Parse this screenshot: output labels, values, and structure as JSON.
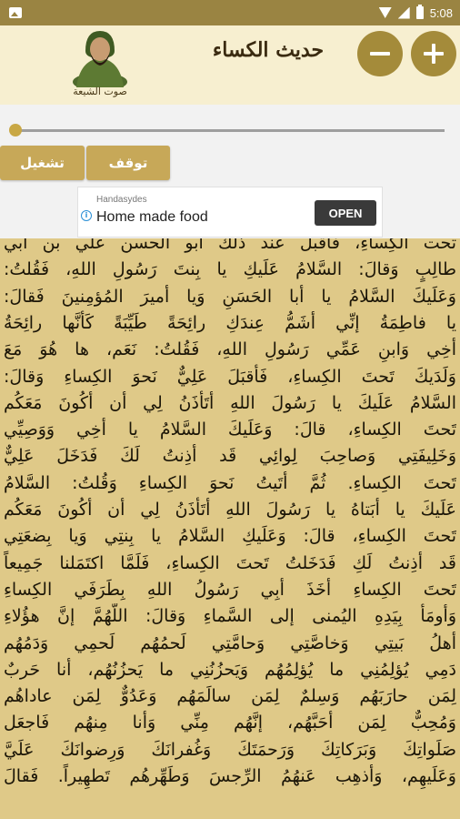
{
  "status_bar": {
    "time": "5:08",
    "icons": [
      "image-icon",
      "wifi-icon",
      "signal-icon",
      "battery-icon"
    ]
  },
  "toolbar": {
    "title": "حديث الكساء",
    "logo_caption": "صوت الشيعة",
    "icons": {
      "zoom_in": "plus-icon",
      "zoom_out": "minus-icon"
    }
  },
  "player": {
    "progress": 0,
    "play_label": "تشغيل",
    "stop_label": "توقف"
  },
  "ad": {
    "advertiser": "Handasydes",
    "headline": "Home made food",
    "cta": "OPEN"
  },
  "colors": {
    "status_bar": "#9a8442",
    "toolbar_bg": "#f7efd0",
    "accent": "#a48b3a",
    "button": "#c7a858",
    "text_bg": "#dfc988"
  },
  "text_lines": [
    "تحت الكِساءِ، فأقبل عند ذلك أبو الحسن علي بن أبي",
    "طالِبٍ وَقالَ: السَّلامُ عَلَيكِ يا بِنتَ رَسُولِ اللهِ، فَقُلتُ:",
    "وَعَلَيكَ السَّلامُ يا أبا الحَسَنِ وَيا أميرَ المُؤمِنينَ فَقالَ:",
    "يا فاطِمَةُ إنِّي أشَمُّ عِندَكِ رائِحَةً طَيِّبَةً كَأنَّها رائِحَةُ",
    "أخِي وَابنِ عَمِّي رَسُولِ اللهِ، فَقُلتُ: نَعَم، ها هُوَ مَعَ",
    "وَلَدَيكَ تَحتَ الكِساءِ، فَأقبَلَ عَلِيٌّ نَحوَ الكِساءِ وَقالَ:",
    "السَّلامُ عَلَيكَ يا رَسُولَ اللهِ أتَأذَنُ لِي أن أكُونَ مَعَكُم",
    "تَحتَ الكِساءِ، قالَ: وَعَلَيكَ السَّلامُ يا أخِي وَوَصِيِّي",
    "وَخَلِيفَتِي وَصاحِبَ لِوائِي قَد أذِنتُ لَكَ فَدَخَلَ عَلِيٌّ",
    "تَحتَ الكِساءِ. ثُمَّ أتَيتُ نَحوَ الكِساءِ وَقُلتُ: السَّلامُ",
    "عَلَيكَ يا أبَتاهُ يا رَسُولَ اللهِ أتَأذَنُ لِي أن أكُونَ مَعَكُم",
    "تَحتَ الكِساءِ، قالَ: وَعَلَيكِ السَّلامُ يا بِنتِي وَيا بِضعَتِي",
    "قَد أذِنتُ لَكِ فَدَخَلتُ تَحتَ الكِساءِ، فَلَمَّا اكتَمَلنا جَمِيعاً",
    "تَحتَ الكِساءِ أخَذَ أبِي رَسُولُ اللهِ بِطَرَفَي الكِساءِ",
    "وَأومَأ بِيَدِهِ اليُمنى إلى السَّماءِ وَقالَ: اللّهُمَّ إنَّ هؤُلاءِ",
    "أهلُ بَيتِي وَخاصَّتِي وَحامَّتِي لَحمُهُم لَحمِي وَدَمُهُم",
    "دَمِي يُؤلِمُنِي ما يُؤلِمُهُم وَيَحزُنُنِي ما يَحزُنُهُم، أنا حَربٌ",
    "لِمَن حارَبَهُم وَسِلمٌ لِمَن سالَمَهُم وَعَدُوٌّ لِمَن عاداهُم",
    "وَمُحِبٌّ لِمَن أحَبَّهُم، إنَّهُم مِنِّي وَأنا مِنهُم فَاجعَل",
    "صَلَواتِكَ وَبَرَكاتِكَ وَرَحمَتَكَ وَغُفرانَكَ وَرِضوانَكَ عَلَيَّ",
    "وَعَلَيهِم، وَأذهِب عَنهُمُ الرِّجسَ وَطَهِّرهُم تَطهِيراً. فَقالَ"
  ]
}
